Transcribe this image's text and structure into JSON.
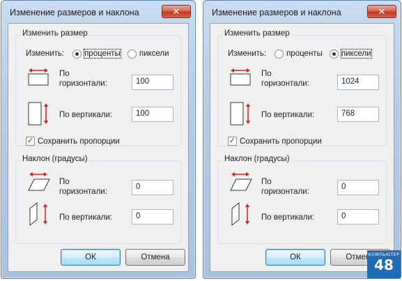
{
  "dialogs": [
    {
      "title": "Изменение размеров и наклона",
      "close": "✕",
      "resize": {
        "group_title": "Изменить размер",
        "by_label": "Изменить:",
        "option_percent": "проценты",
        "option_pixels": "пиксели",
        "selected": "percent",
        "horiz_label_1": "По",
        "horiz_label_2": "горизонтали:",
        "horiz_value": "100",
        "vert_label": "По вертикали:",
        "vert_value": "100",
        "keep_ratio_label": "Сохранить пропорции",
        "keep_ratio_checked": true
      },
      "skew": {
        "group_title": "Наклон (градусы)",
        "horiz_label_1": "По",
        "horiz_label_2": "горизонтали:",
        "horiz_value": "0",
        "vert_label": "По вертикали:",
        "vert_value": "0"
      },
      "ok_label": "ОК",
      "cancel_label": "Отмена"
    },
    {
      "title": "Изменение размеров и наклона",
      "close": "✕",
      "resize": {
        "group_title": "Изменить размер",
        "by_label": "Изменить:",
        "option_percent": "проценты",
        "option_pixels": "пиксели",
        "selected": "pixels",
        "horiz_label_1": "По",
        "horiz_label_2": "горизонтали:",
        "horiz_value": "1024",
        "vert_label": "По вертикали:",
        "vert_value": "768",
        "keep_ratio_label": "Сохранить пропорции",
        "keep_ratio_checked": true
      },
      "skew": {
        "group_title": "Наклон (градусы)",
        "horiz_label_1": "По",
        "horiz_label_2": "горизонтали:",
        "horiz_value": "0",
        "vert_label": "По вертикали:",
        "vert_value": "0"
      },
      "ok_label": "ОК",
      "cancel_label": "Отмена"
    }
  ],
  "watermark": {
    "top": "КОМПЬЮТЕР",
    "number": "48"
  },
  "colors": {
    "arrow": "#d62020",
    "titlebar": "#b4cce6",
    "close": "#c0391f",
    "watermark": "#1f6bb5"
  },
  "icons": [
    "resize-horizontal-icon",
    "resize-vertical-icon",
    "skew-horizontal-icon",
    "skew-vertical-icon",
    "close-icon"
  ]
}
